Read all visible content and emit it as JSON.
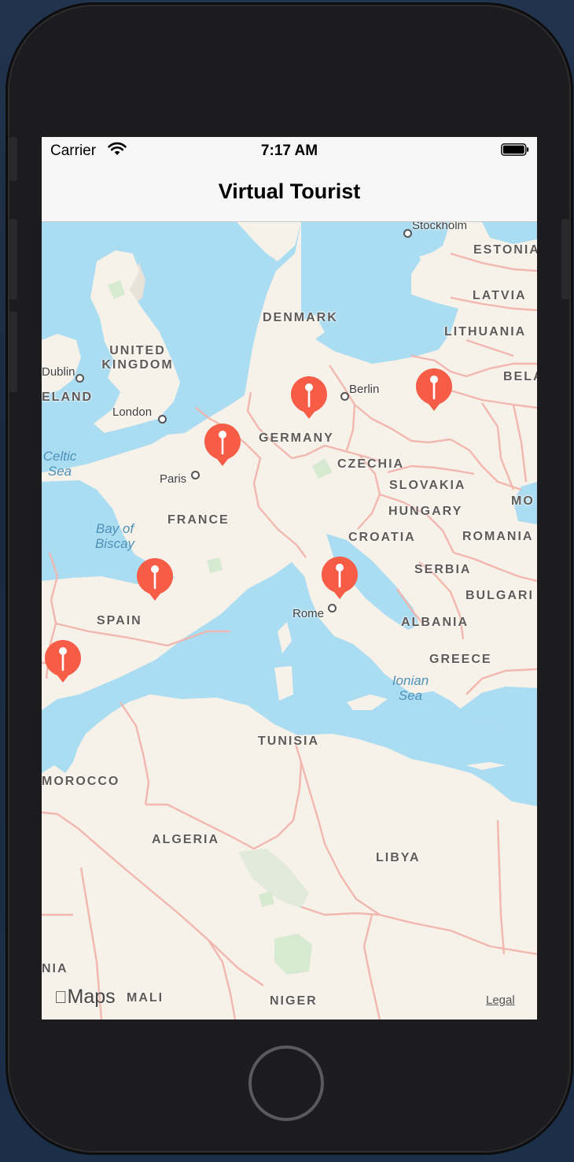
{
  "status_bar": {
    "carrier": "Carrier",
    "time": "7:17 AM"
  },
  "nav": {
    "title": "Virtual Tourist"
  },
  "map": {
    "countries": {
      "denmark": "DENMARK",
      "uk_line1": "UNITED",
      "uk_line2": "KINGDOM",
      "ireland": "ELAND",
      "germany": "GERMANY",
      "czechia": "CZECHIA",
      "slovakia": "SLOVAKIA",
      "hungary": "HUNGARY",
      "croatia": "CROATIA",
      "romania": "ROMANIA",
      "serbia": "SERBIA",
      "bulgaria": "BULGARI",
      "albania": "ALBANIA",
      "greece": "GREECE",
      "france": "FRANCE",
      "spain": "SPAIN",
      "tunisia": "TUNISIA",
      "morocco": "MOROCCO",
      "algeria": "ALGERIA",
      "libya": "LIBYA",
      "mali": "MALI",
      "niger": "NIGER",
      "estonia": "ESTONIA",
      "latvia": "LATVIA",
      "lithuania": "LITHUANIA",
      "belarus": "BELA",
      "moldova": "MO",
      "mauritania": "NIA"
    },
    "cities": {
      "stockholm": "Stockholm",
      "berlin": "Berlin",
      "dublin": "Dublin",
      "london": "London",
      "paris": "Paris",
      "rome": "Rome"
    },
    "seas": {
      "celtic_1": "Celtic",
      "celtic_2": "Sea",
      "biscay_1": "Bay of",
      "biscay_2": "Biscay",
      "ionian_1": "Ionian",
      "ionian_2": "Sea"
    },
    "pin_color": "#f75c47",
    "water_color": "#aadcf2",
    "land_color": "#f6f1e9",
    "border_color": "#f2b4ac",
    "attribution": {
      "logo_text": "Maps",
      "legal": "Legal"
    }
  }
}
